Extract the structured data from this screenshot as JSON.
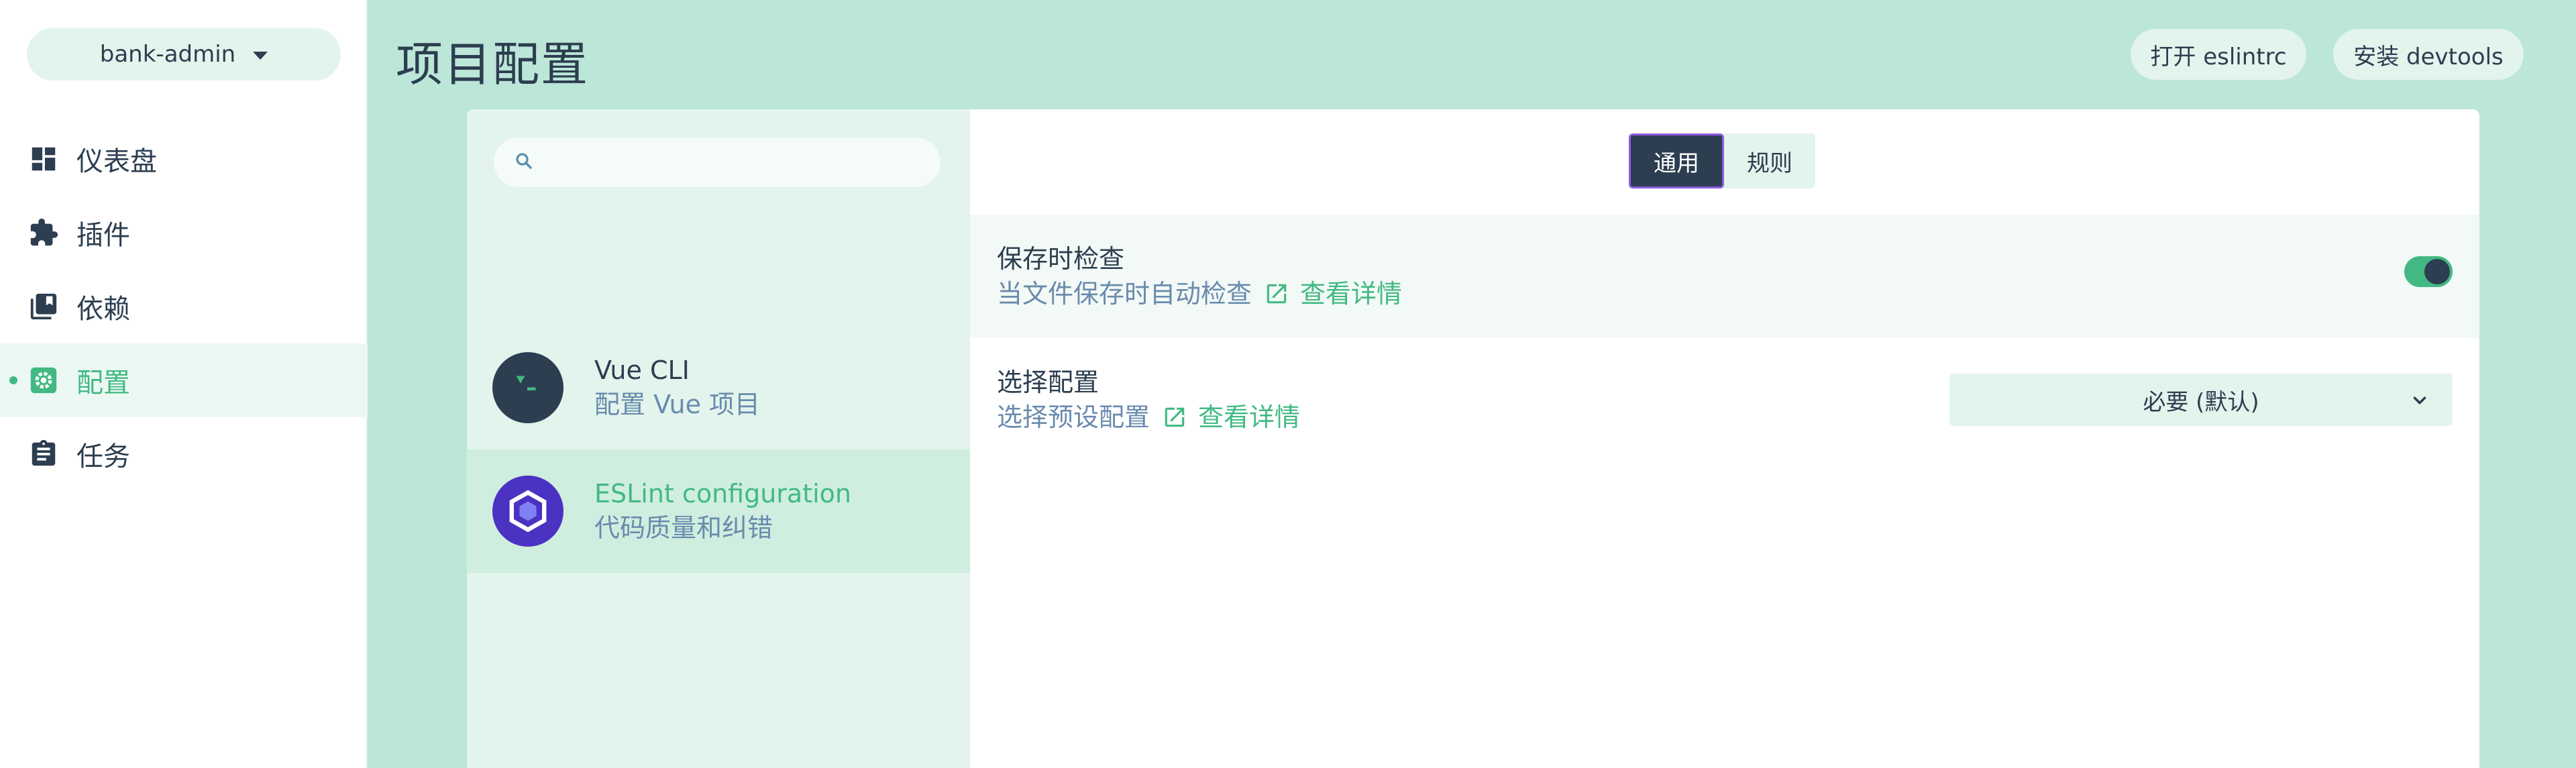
{
  "sidebar": {
    "project_name": "bank-admin",
    "nav": [
      {
        "label": "仪表盘",
        "icon": "dashboard-icon"
      },
      {
        "label": "插件",
        "icon": "puzzle-icon"
      },
      {
        "label": "依赖",
        "icon": "library-icon"
      },
      {
        "label": "配置",
        "icon": "gear-icon",
        "active": true
      },
      {
        "label": "任务",
        "icon": "clipboard-icon"
      }
    ]
  },
  "header": {
    "title": "项目配置",
    "open_eslintrc": "打开 eslintrc",
    "install_devtools": "安装 devtools"
  },
  "configs": {
    "search": {
      "value": "",
      "placeholder": ""
    },
    "items": [
      {
        "name": "Vue CLI",
        "description": "配置 Vue 项目",
        "icon": "vue-cli-terminal-icon"
      },
      {
        "name": "ESLint configuration",
        "description": "代码质量和纠错",
        "icon": "eslint-hexagon-icon",
        "selected": true
      }
    ]
  },
  "tabs": [
    {
      "label": "通用",
      "active": true
    },
    {
      "label": "规则",
      "active": false
    }
  ],
  "prompts": [
    {
      "title": "保存时检查",
      "description": "当文件保存时自动检查",
      "link": "查看详情",
      "control": "toggle",
      "value": true
    },
    {
      "title": "选择配置",
      "description": "选择预设配置",
      "link": "查看详情",
      "control": "select",
      "value": "必要 (默认)"
    }
  ],
  "colors": {
    "background": "#bce6d7",
    "accent": "#42b983",
    "text": "#2c3e50",
    "muted": "#6a8bad",
    "active_tab_border": "#8e5bde",
    "eslint_purple": "#4b32c3"
  }
}
